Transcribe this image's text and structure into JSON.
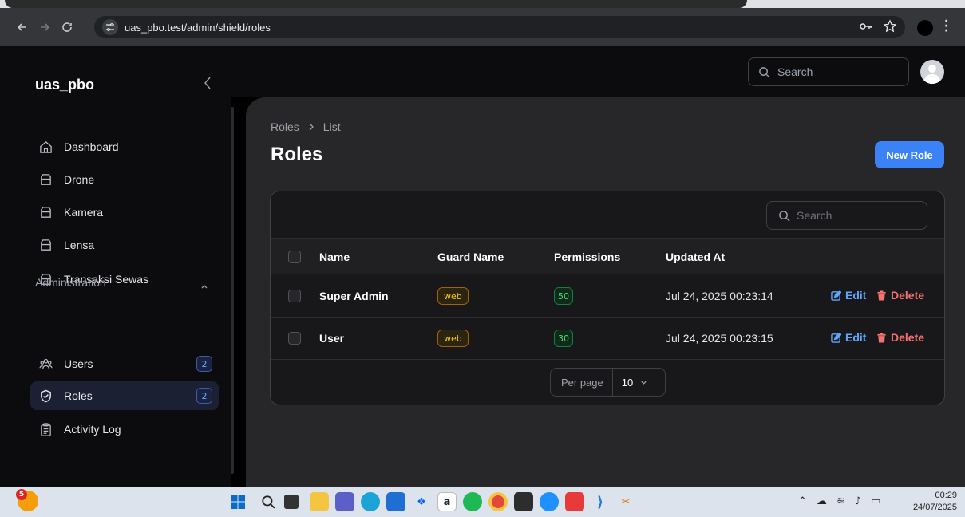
{
  "browser": {
    "url": "uas_pbo.test/admin/shield/roles"
  },
  "app": {
    "brand": "uas_pbo",
    "search_placeholder": "Search"
  },
  "sidebar": {
    "items": [
      {
        "label": "Dashboard",
        "icon": "home-icon"
      },
      {
        "label": "Drone",
        "icon": "box-icon"
      },
      {
        "label": "Kamera",
        "icon": "box-icon"
      },
      {
        "label": "Lensa",
        "icon": "box-icon"
      },
      {
        "label": "Transaksi Sewas",
        "icon": "box-icon"
      }
    ],
    "group_label": "Administration",
    "admin_items": [
      {
        "label": "Users",
        "icon": "users-icon",
        "badge": "2"
      },
      {
        "label": "Roles",
        "icon": "shield-check-icon",
        "badge": "2",
        "active": true
      },
      {
        "label": "Activity Log",
        "icon": "clipboard-icon"
      }
    ]
  },
  "page": {
    "breadcrumb": [
      "Roles",
      "List"
    ],
    "title": "Roles",
    "new_button": "New Role"
  },
  "table": {
    "search_placeholder": "Search",
    "columns": [
      "Name",
      "Guard Name",
      "Permissions",
      "Updated At"
    ],
    "rows": [
      {
        "name": "Super Admin",
        "guard": "web",
        "permissions": "50",
        "updated_at": "Jul 24, 2025 00:23:14"
      },
      {
        "name": "User",
        "guard": "web",
        "permissions": "30",
        "updated_at": "Jul 24, 2025 00:23:15"
      }
    ],
    "edit_label": "Edit",
    "delete_label": "Delete",
    "per_page_label": "Per page",
    "per_page_value": "10"
  },
  "taskbar": {
    "notification_badge": "5",
    "time": "00:29",
    "date": "24/07/2025"
  },
  "colors": {
    "primary": "#3b82f6",
    "danger": "#f87171",
    "warning": "#facc15",
    "success": "#4ade80"
  }
}
